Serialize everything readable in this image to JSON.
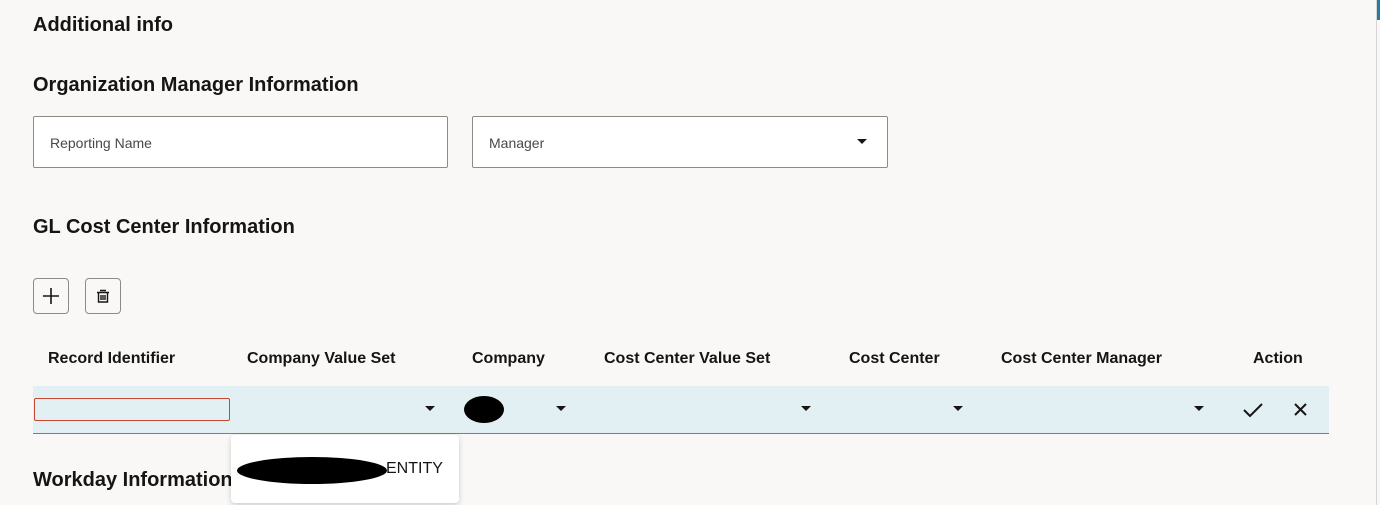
{
  "sections": {
    "additional_info": "Additional info",
    "org_manager": "Organization Manager Information",
    "gl_cost_center": "GL Cost Center Information",
    "workday": "Workday Information"
  },
  "fields": {
    "reporting_name_placeholder": "Reporting Name",
    "manager_placeholder": "Manager"
  },
  "toolbar": {
    "add_icon": "plus-icon",
    "delete_icon": "trash-icon"
  },
  "table": {
    "columns": [
      "Record Identifier",
      "Company Value Set",
      "Company",
      "Cost Center Value Set",
      "Cost Center",
      "Cost Center Manager",
      "Action"
    ],
    "row": {
      "record_identifier": "",
      "company_value_set": "",
      "company": "",
      "cost_center_value_set": "",
      "cost_center": "",
      "cost_center_manager": ""
    }
  },
  "dropdown_menu": {
    "options": [
      "ENTITY"
    ]
  },
  "colors": {
    "background": "#f9f8f6",
    "row_highlight": "#e3f0f3",
    "error_border": "#c74634",
    "accent": "#227e9e"
  }
}
